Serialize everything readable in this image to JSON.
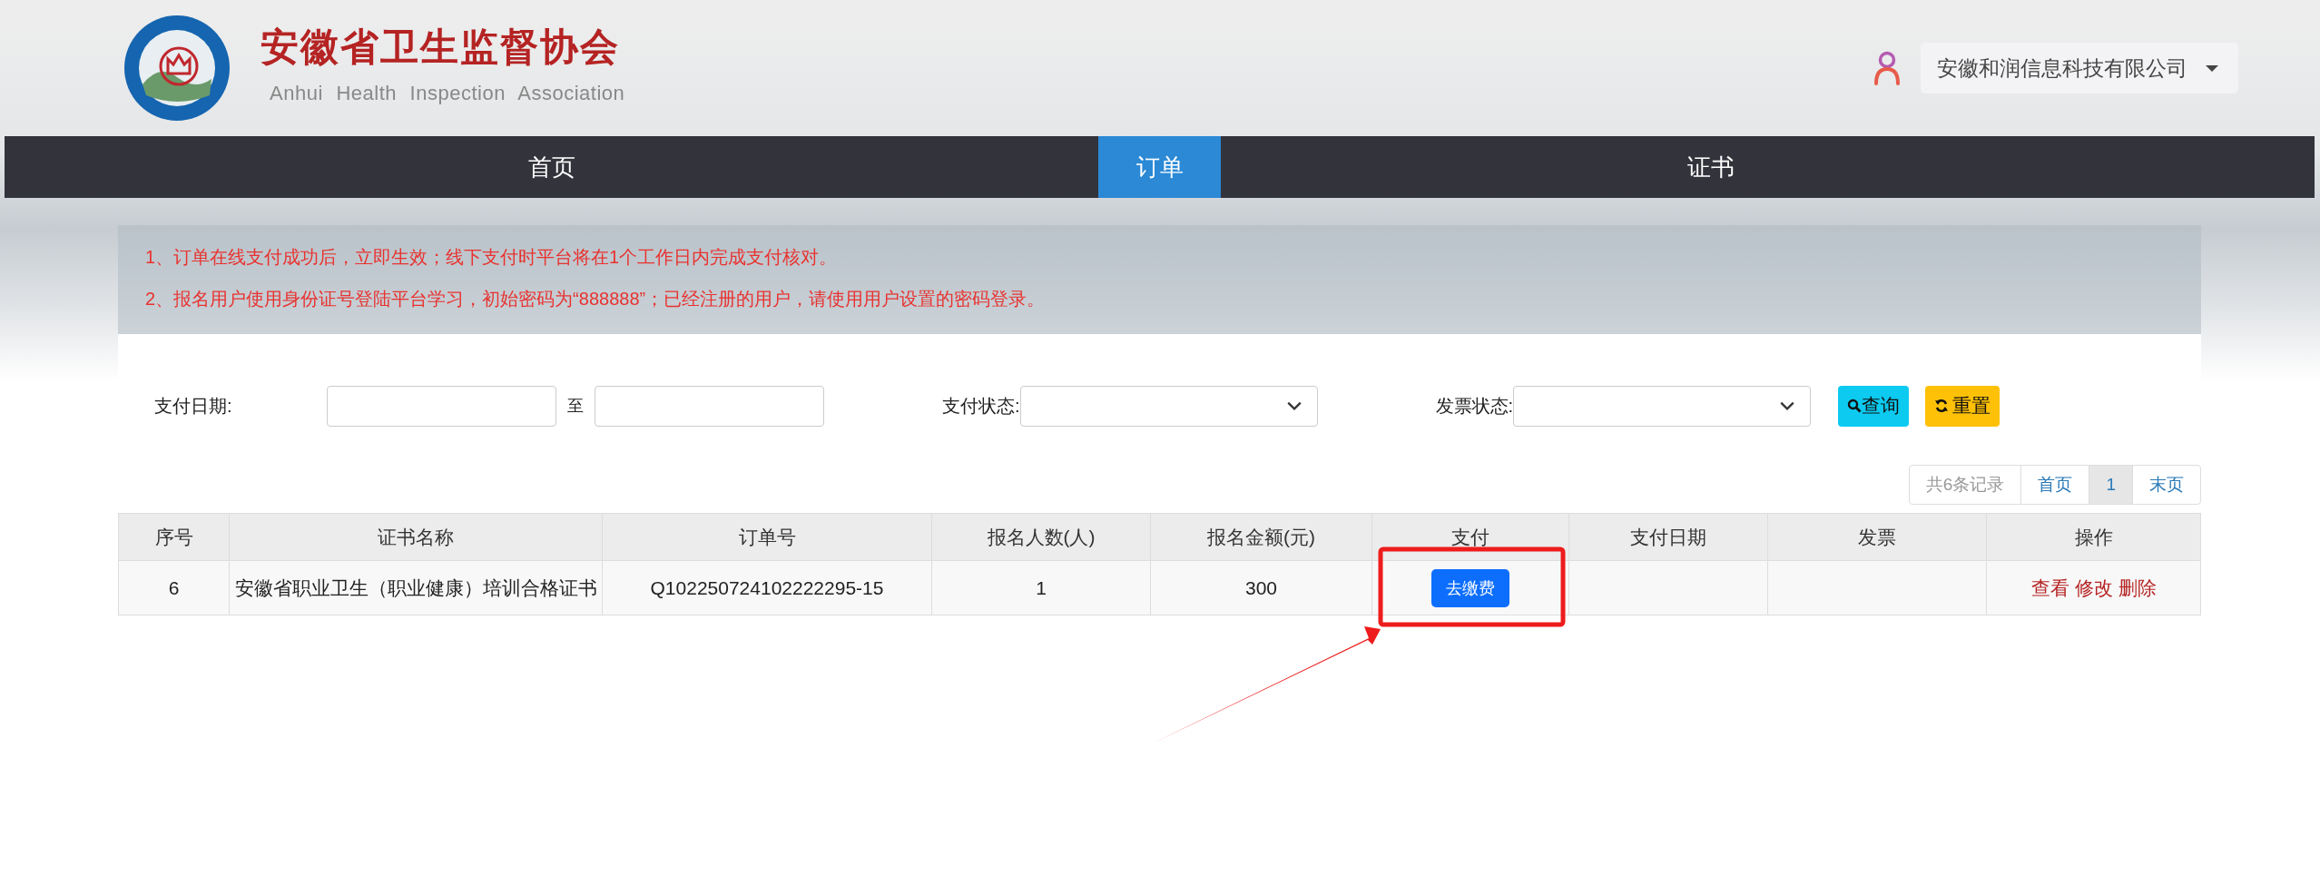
{
  "header": {
    "title": "安徽省卫生监督协会",
    "subtitle": "Anhui Health Inspection Association",
    "user": "安徽和润信息科技有限公司"
  },
  "nav": [
    {
      "label": "首页",
      "selected": false
    },
    {
      "label": "订单",
      "selected": true
    },
    {
      "label": "证书",
      "selected": false
    }
  ],
  "notices": [
    "1、订单在线支付成功后，立即生效；线下支付时平台将在1个工作日内完成支付核对。",
    "2、报名用户使用身份证号登陆平台学习，初始密码为“888888”；已经注册的用户，请使用用户设置的密码登录。"
  ],
  "filters": {
    "date_label": "支付日期:",
    "date_separator": "至",
    "pay_status_label": "支付状态:",
    "invoice_status_label": "发票状态:",
    "buttons": [
      {
        "label": "查询",
        "kind": "search"
      },
      {
        "label": "重置",
        "kind": "reset"
      }
    ]
  },
  "pagination": {
    "summary": "共6条记录",
    "pages": [
      {
        "label": "首页",
        "selected": false
      },
      {
        "label": "1",
        "selected": true
      },
      {
        "label": "末页",
        "selected": false
      }
    ]
  },
  "table": {
    "columns": [
      "序号",
      "证书名称",
      "订单号",
      "报名人数(人)",
      "报名金额(元)",
      "支付",
      "支付日期",
      "发票",
      "操作"
    ],
    "rows": [
      {
        "cells": [
          {
            "kind": "text",
            "text": "6"
          },
          {
            "kind": "text",
            "text": "安徽省职业卫生（职业健康）培训合格证书"
          },
          {
            "kind": "text",
            "text": "Q102250724102222295-15"
          },
          {
            "kind": "text",
            "text": "1"
          },
          {
            "kind": "text",
            "text": "300"
          },
          {
            "kind": "button",
            "text": "去缴费"
          },
          {
            "kind": "blank"
          },
          {
            "kind": "blank"
          },
          {
            "kind": "links",
            "links": [
              "查看",
              "修改",
              "删除"
            ]
          }
        ]
      }
    ]
  }
}
